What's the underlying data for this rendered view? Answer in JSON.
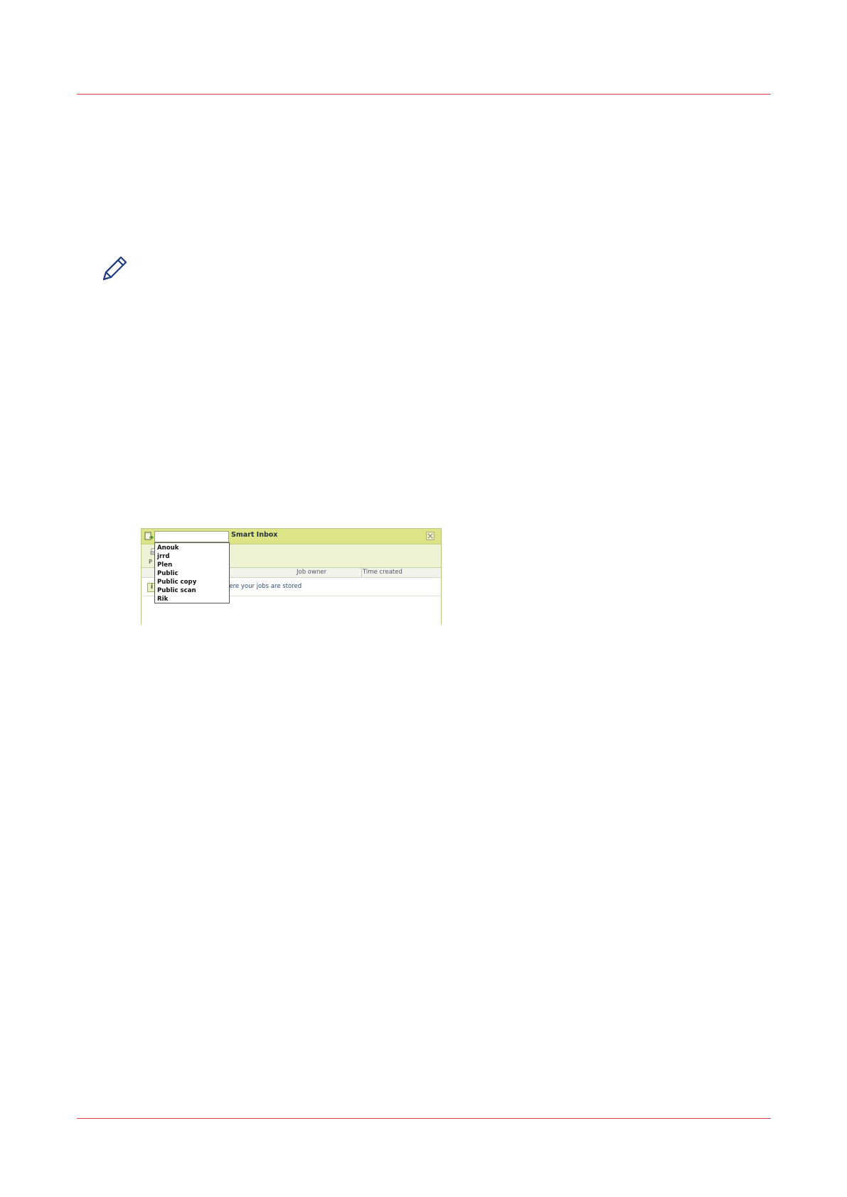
{
  "figure": {
    "window_title": "Smart Inbox",
    "search_value": "",
    "toolbar_label": "P",
    "columns": [
      "Job owner",
      "Time created"
    ],
    "info_icon_glyph": "i",
    "info_text": "here your jobs are stored",
    "dropdown_items": [
      "Anouk",
      "jrrd",
      "Plen",
      "Public",
      "Public copy",
      "Public scan",
      "Rik"
    ]
  },
  "icons": {
    "note": "pencil-note-icon",
    "app": "inbox-icon",
    "close": "close-icon",
    "toolbar": "printer-icon",
    "info": "info-icon"
  },
  "colors": {
    "rule": "#e0404a",
    "titlebar": "#dde387",
    "toolbar": "#eff2d4",
    "link_text": "#2b4d6e"
  }
}
